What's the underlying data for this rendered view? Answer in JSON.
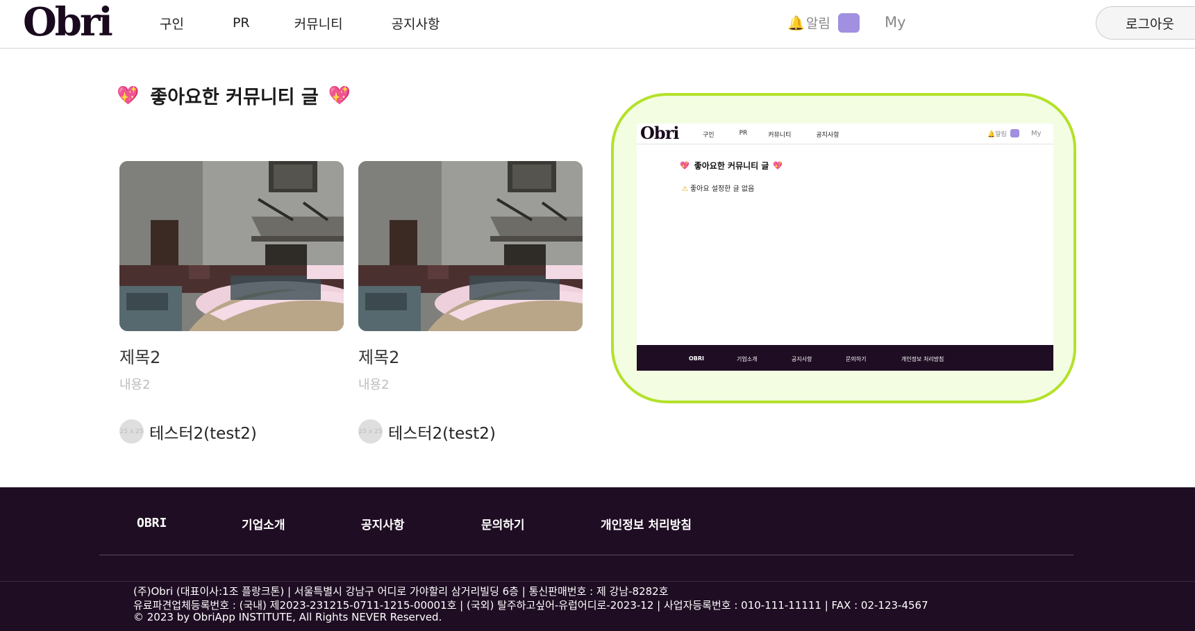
{
  "header": {
    "logo": "Obri",
    "nav": [
      "구인",
      "PR",
      "커뮤니티",
      "공지사항"
    ],
    "alarm_label": "알림",
    "my_label": "My",
    "logout_label": "로그아웃"
  },
  "main": {
    "title": "좋아요한 커뮤니티 글",
    "posts": [
      {
        "title": "제목2",
        "content": "내용2",
        "author": "테스터2(test2)",
        "avatar_placeholder": "25 x 25"
      },
      {
        "title": "제목2",
        "content": "내용2",
        "author": "테스터2(test2)",
        "avatar_placeholder": "25 x 25"
      }
    ]
  },
  "preview": {
    "logo": "Obri",
    "nav": [
      "구인",
      "PR",
      "커뮤니티",
      "공지사항"
    ],
    "alarm_label": "알림",
    "my_label": "My",
    "title": "좋아요한 커뮤니티 글",
    "empty_message": "좋아요 설정한 글 없음",
    "footer_logo": "OBRI",
    "footer_links": [
      "기업소개",
      "공지사항",
      "문의하기",
      "개인정보 처리방침"
    ]
  },
  "footer": {
    "logo": "OBRI",
    "links": [
      "기업소개",
      "공지사항",
      "문의하기",
      "개인정보 처리방침"
    ],
    "info": [
      "(주)Obri (대표이사:1조 플랑크톤) | 서울특별시 강남구 어디로 가야할리 삼거리빌딩 6층 | 통신판매번호 : 제 강남-8282호",
      "유료파견업체등록번호 : (국내) 제2023-231215-0711-1215-00001호 | (국외) 탈주하고싶어-유럽어디로-2023-12 | 사업자등록번호 : 010-111-11111 | FAX : 02-123-4567",
      "© 2023 by ObriApp INSTITUTE, All Rights NEVER Reserved."
    ]
  },
  "colors": {
    "footer_bg": "#1f0e23",
    "accent_purple": "#a18fe0",
    "preview_border": "#b4e12a",
    "heart": "#e9365f"
  }
}
